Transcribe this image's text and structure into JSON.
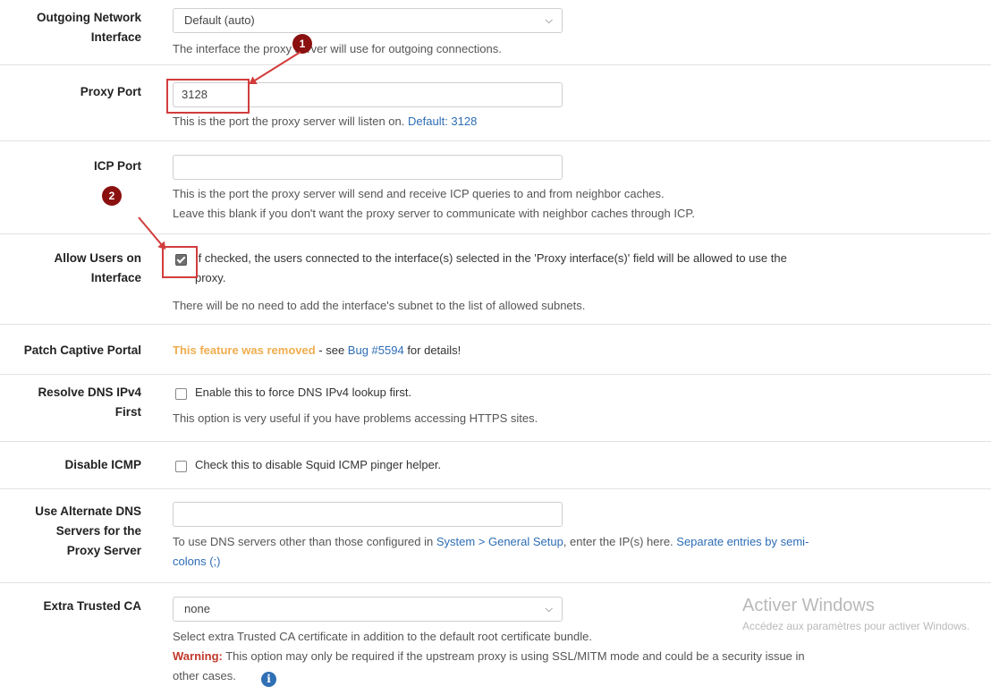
{
  "rows": {
    "outgoing": {
      "label_line1": "Outgoing Network",
      "label_line2": "Interface",
      "select_value": "Default (auto)",
      "desc": "The interface the proxy server will use for outgoing connections."
    },
    "proxy_port": {
      "label": "Proxy Port",
      "value": "3128",
      "desc": "This is the port the proxy server will listen on.",
      "default_link": "Default: 3128"
    },
    "icp_port": {
      "label": "ICP Port",
      "value": "",
      "desc_line1": "This is the port the proxy server will send and receive ICP queries to and from neighbor caches.",
      "desc_line2": "Leave this blank if you don't want the proxy server to communicate with neighbor caches through ICP."
    },
    "allow_users": {
      "label_line1": "Allow Users on",
      "label_line2": "Interface",
      "checked": true,
      "text_line1": "If checked, the users connected to the interface(s) selected in the 'Proxy interface(s)' field will be allowed to use the",
      "text_line2": "proxy.",
      "desc": "There will be no need to add the interface's subnet to the list of allowed subnets."
    },
    "patch_captive": {
      "label": "Patch Captive Portal",
      "removed": "This feature was removed",
      "see": " - see ",
      "bug_link": "Bug #5594",
      "details": " for details!"
    },
    "resolve_dns": {
      "label_line1": "Resolve DNS IPv4",
      "label_line2": "First",
      "checked": false,
      "text": "Enable this to force DNS IPv4 lookup first.",
      "desc": "This option is very useful if you have problems accessing HTTPS sites."
    },
    "disable_icmp": {
      "label": "Disable ICMP",
      "checked": false,
      "text": "Check this to disable Squid ICMP pinger helper."
    },
    "alt_dns": {
      "label_line1": "Use Alternate DNS",
      "label_line2": "Servers for the",
      "label_line3": "Proxy Server",
      "value": "",
      "desc_pre": "To use DNS servers other than those configured in ",
      "desc_link": "System > General Setup",
      "desc_mid": ", enter the IP(s) here. ",
      "desc_link2": "Separate entries by semi-",
      "desc_line2_link": "colons (;)"
    },
    "extra_ca": {
      "label": "Extra Trusted CA",
      "select_value": "none",
      "desc": "Select extra Trusted CA certificate in addition to the default root certificate bundle.",
      "warning_label": "Warning:",
      "warning_text": " This option may only be required if the upstream proxy is using SSL/MITM mode and could be a security issue in",
      "warning_line2": "other cases."
    }
  },
  "annotations": {
    "badge1": "1",
    "badge2": "2"
  },
  "watermark": {
    "title": "Activer Windows",
    "subtitle": "Accédez aux paramètres pour activer Windows."
  },
  "icons": {
    "dropdown": "chevron-down-icon",
    "info": "info-icon"
  },
  "colors": {
    "link": "#2d6db5",
    "removed": "#f0ad4e",
    "warning": "#c0392b",
    "annotation": "#d23c3c"
  }
}
